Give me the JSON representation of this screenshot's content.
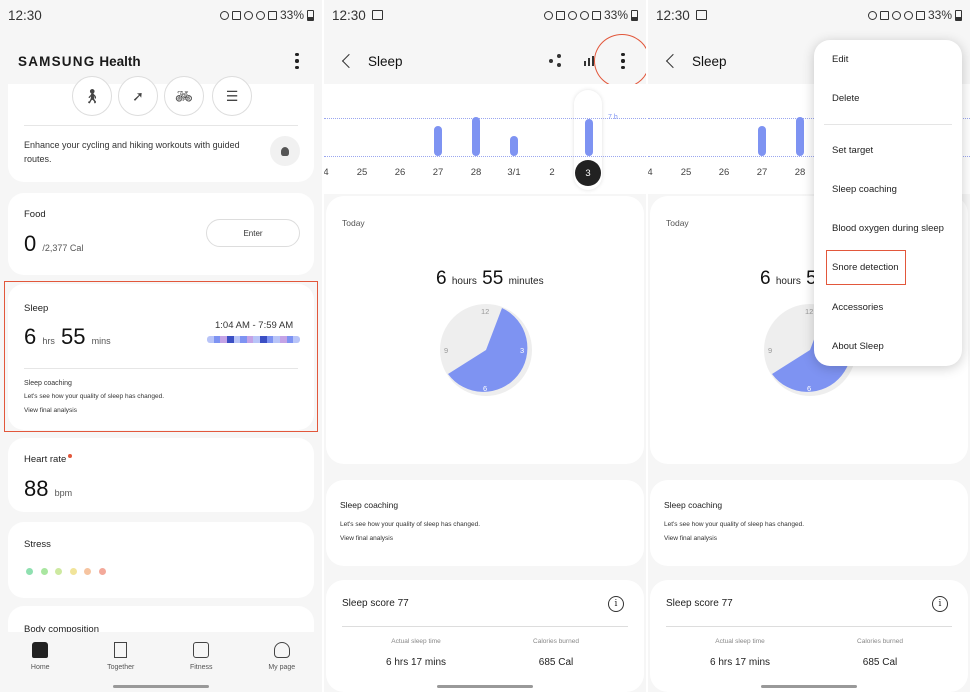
{
  "status": {
    "time": "12:30",
    "battery": "33%"
  },
  "home": {
    "brand": "SAMSUNG",
    "brand_suffix": "Health",
    "workout_text": "Enhance your cycling and hiking workouts with guided routes.",
    "food": {
      "title": "Food",
      "value": "0",
      "unit": "/2,377 Cal",
      "button": "Enter"
    },
    "sleep": {
      "title": "Sleep",
      "hours": "6",
      "hours_unit": "hrs",
      "mins": "55",
      "mins_unit": "mins",
      "range": "1:04 AM - 7:59 AM",
      "coaching_title": "Sleep coaching",
      "coaching_text": "Let's see how your quality of sleep has changed.",
      "coaching_link": "View final analysis"
    },
    "heart": {
      "title": "Heart rate",
      "value": "88",
      "unit": "bpm"
    },
    "stress": {
      "title": "Stress",
      "dot_colors": [
        "#8fe0b0",
        "#a9e6a0",
        "#cde9a0",
        "#f1e49a",
        "#f6c4a0",
        "#f3a99a"
      ]
    },
    "body_title": "Body composition",
    "nav": [
      {
        "label": "Home",
        "icon": "home-icon"
      },
      {
        "label": "Together",
        "icon": "flag-icon"
      },
      {
        "label": "Fitness",
        "icon": "fitness-icon"
      },
      {
        "label": "My page",
        "icon": "user-icon"
      }
    ]
  },
  "sleep_screen": {
    "title": "Sleep",
    "target_label": "7 h",
    "days": [
      "4",
      "25",
      "26",
      "27",
      "28",
      "3/1",
      "2",
      "3"
    ],
    "bar_hours": [
      null,
      null,
      null,
      5.5,
      7.2,
      3.6,
      null,
      6.9
    ],
    "selected_day": "3",
    "today": "Today",
    "duration_hours": "6",
    "duration_hours_unit": "hours",
    "duration_mins": "55",
    "duration_mins_unit": "minutes",
    "clock_numbers": [
      "12",
      "3",
      "6",
      "9"
    ],
    "coaching_title": "Sleep coaching",
    "coaching_text": "Let's see how your quality of sleep has changed.",
    "coaching_link": "View final analysis",
    "score_label": "Sleep score 77",
    "actual_label": "Actual sleep time",
    "actual_value": "6 hrs 17 mins",
    "calories_label": "Calories burned",
    "calories_value": "685 Cal"
  },
  "menu": {
    "items": [
      "Edit",
      "Delete",
      "Set target",
      "Sleep coaching",
      "Blood oxygen during sleep",
      "Snore detection",
      "Accessories",
      "About Sleep"
    ]
  },
  "colors": {
    "accent": "#7e93f2",
    "highlight": "#e2573b"
  }
}
